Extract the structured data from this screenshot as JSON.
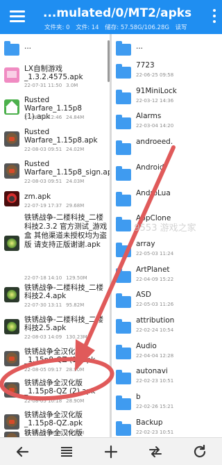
{
  "header": {
    "path": "...mulated/0/MT2/apks",
    "folders_label": "文件夹: 0",
    "files_label": "文件: 14",
    "storage_label": "储存: 57.58G/106.28G",
    "mode_label": "读写"
  },
  "left_pane": {
    "up_label": "...",
    "files": [
      {
        "icon": "pink-apk-icon",
        "name": "LX自制游戏_1.3.2.4575.apk",
        "date": "22-07-31 11:50",
        "size": "3.0M"
      },
      {
        "icon": "green-home-apk-icon",
        "name": "Rusted Warfare_1.15p8 (1).apk",
        "date": "22-08-04 12:46",
        "size": "24.84M"
      },
      {
        "icon": "robot-apk-icon",
        "name": "Rusted Warfare_1.15p8.apk",
        "date": "22-08-03 09:51",
        "size": "24.02M"
      },
      {
        "icon": "robot-apk-icon",
        "name": "Rusted Warfare_1.15p8_sign.apk",
        "date": "22-08-03 09:51",
        "size": "24.03M"
      },
      {
        "icon": "zm-apk-icon",
        "name": "zm.apk",
        "date": "22-07-19 17:37",
        "size": "29.68M"
      },
      {
        "icon": "game-apk-icon",
        "name": "铁锈战争-二楼科技_二楼科技2.3.2 官方测试_游戏盒 其他渠道未授权均为盗版 请支持正版谢谢.apk",
        "date": "22-07-18 14:10",
        "size": "129.50M"
      },
      {
        "icon": "game-apk-icon",
        "name": "铁锈战争-二楼科技_二楼科技2.4.apk",
        "date": "22-07-30 13:11",
        "size": "95.82M"
      },
      {
        "icon": "game-apk-icon",
        "name": "铁锈战争-二楼科技_二楼科技2.5.apk",
        "date": "22-08-03 14:09",
        "size": "130.23M"
      },
      {
        "icon": "robot-apk-icon",
        "name": "铁锈战争全汉化版_1.15p8-QZ (1).apk",
        "date": "22-08-05 09:17",
        "size": "28.90M"
      },
      {
        "icon": "robot-apk-icon",
        "name": "铁锈战争全汉化版_1.15p8-QZ (2).apk",
        "date": "22-08-05 10:18",
        "size": "28.90M"
      },
      {
        "icon": "robot-apk-icon",
        "name": "铁锈战争全汉化版_1.15p8-QZ.apk",
        "date": "22-08-05 08:34",
        "size": "28.90M"
      },
      {
        "icon": "robot-apk-icon",
        "name": "铁锈战争全汉化版",
        "date": "",
        "size": ""
      }
    ]
  },
  "right_pane": {
    "up_label": "...",
    "folders": [
      {
        "name": "7723",
        "date": "22-06-25 09:58"
      },
      {
        "name": "91MiniLock",
        "date": "22-03-12 14:36"
      },
      {
        "name": "Alarms",
        "date": "22-03-04 14:20"
      },
      {
        "name": "androeed.",
        "date": ""
      },
      {
        "name": "Android",
        "date": ""
      },
      {
        "name": "AndroLua",
        "date": ""
      },
      {
        "name": "AppClone",
        "date": ""
      },
      {
        "name": "array",
        "date": "22-05-03 11:24"
      },
      {
        "name": "ArtPlanet",
        "date": "22-04-09 15:22"
      },
      {
        "name": "ASD",
        "date": "22-05-03 11:26"
      },
      {
        "name": "attribution",
        "date": "22-02-24 10:54"
      },
      {
        "name": "Audio",
        "date": "22-04-04 12:28"
      },
      {
        "name": "autonavi",
        "date": "22-02-23 10:51"
      },
      {
        "name": "b",
        "date": "22-02-26 15:21"
      },
      {
        "name": "Backup",
        "date": "22-02-23 10:51"
      }
    ]
  },
  "bottom_bar": {
    "buttons": [
      "back-arrow-icon",
      "menu-lines-icon",
      "plus-icon",
      "swap-icon",
      "refresh-icon"
    ]
  },
  "watermark": {
    "text": "9553 游戏之家"
  },
  "colors": {
    "header": "#1f8ef1",
    "folder": "#3f9bf0",
    "annotation": "#e05a5a"
  }
}
